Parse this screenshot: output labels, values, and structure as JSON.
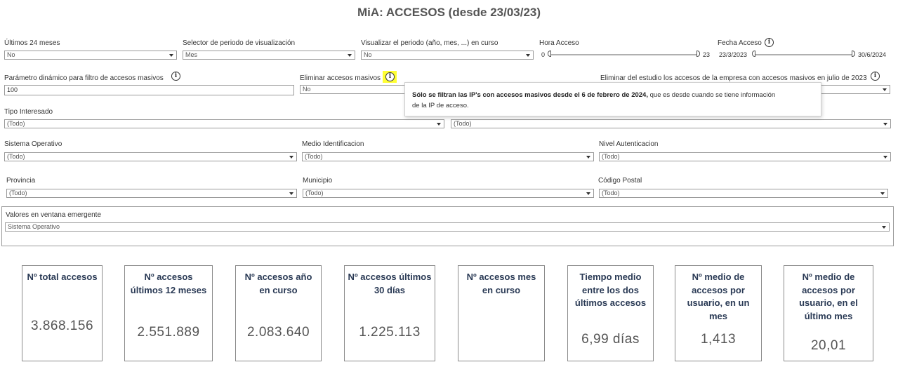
{
  "title": "MiA: ACCESOS (desde 23/03/23)",
  "filters_row1": {
    "ultimos24": {
      "label": "Últimos 24 meses",
      "value": "No"
    },
    "selector": {
      "label": "Selector de periodo de visualización",
      "value": "Mes"
    },
    "visualizar": {
      "label": "Visualizar el periodo (año, mes, ...) en curso",
      "value": "No"
    },
    "hora": {
      "label": "Hora Acceso",
      "min": "0",
      "max": "23"
    },
    "fecha": {
      "label": "Fecha Acceso",
      "min": "23/3/2023",
      "max": "30/6/2024"
    }
  },
  "filters_row2": {
    "parametro": {
      "label": "Parámetro dinámico para filtro de accesos masivos",
      "value": "100"
    },
    "eliminar": {
      "label": "Eliminar accesos masivos",
      "value": "No"
    },
    "eliminar_empresa": {
      "label": "Eliminar del estudio los accesos de la empresa con accesos masivos en julio de 2023"
    }
  },
  "tooltip": {
    "bold": "Sólo se filtran las IP's con accesos masivos desde el 6 de febrero de 2024,",
    "rest_line1": " que es desde cuando se tiene información",
    "line2": "de la IP de acceso."
  },
  "filters_row3": {
    "tipo": {
      "label": "Tipo Interesado",
      "value": "(Todo)"
    },
    "otro": {
      "value": "(Todo)"
    }
  },
  "filters_row4": {
    "so": {
      "label": "Sistema Operativo",
      "value": "(Todo)"
    },
    "medio": {
      "label": "Medio Identificacion",
      "value": "(Todo)"
    },
    "nivel": {
      "label": "Nivel Autenticacion",
      "value": "(Todo)"
    }
  },
  "filters_row5": {
    "provincia": {
      "label": "Provincia",
      "value": "(Todo)"
    },
    "municipio": {
      "label": "Municipio",
      "value": "(Todo)"
    },
    "cp": {
      "label": "Código Postal",
      "value": "(Todo)"
    }
  },
  "ventana": {
    "label": "Valores en ventana emergente",
    "value": "Sistema Operativo"
  },
  "cards": [
    {
      "title": "Nº total accesos",
      "value": "3.868.156"
    },
    {
      "title": "Nº accesos últimos 12 meses",
      "value": "2.551.889"
    },
    {
      "title": "Nº accesos año en curso",
      "value": "2.083.640"
    },
    {
      "title": "Nº accesos últimos 30 días",
      "value": "1.225.113"
    },
    {
      "title": "Nº accesos mes en curso",
      "value": ""
    },
    {
      "title": "Tiempo medio entre los dos últimos accesos",
      "value": "6,99 días"
    },
    {
      "title": "Nº medio de accesos por usuario, en un mes",
      "value": "1,413"
    },
    {
      "title": "Nº medio de accesos por usuario, en el último mes",
      "value": "20,01"
    }
  ],
  "colors": {
    "card_title": "#2a3a55",
    "highlight": "#ffff33"
  }
}
